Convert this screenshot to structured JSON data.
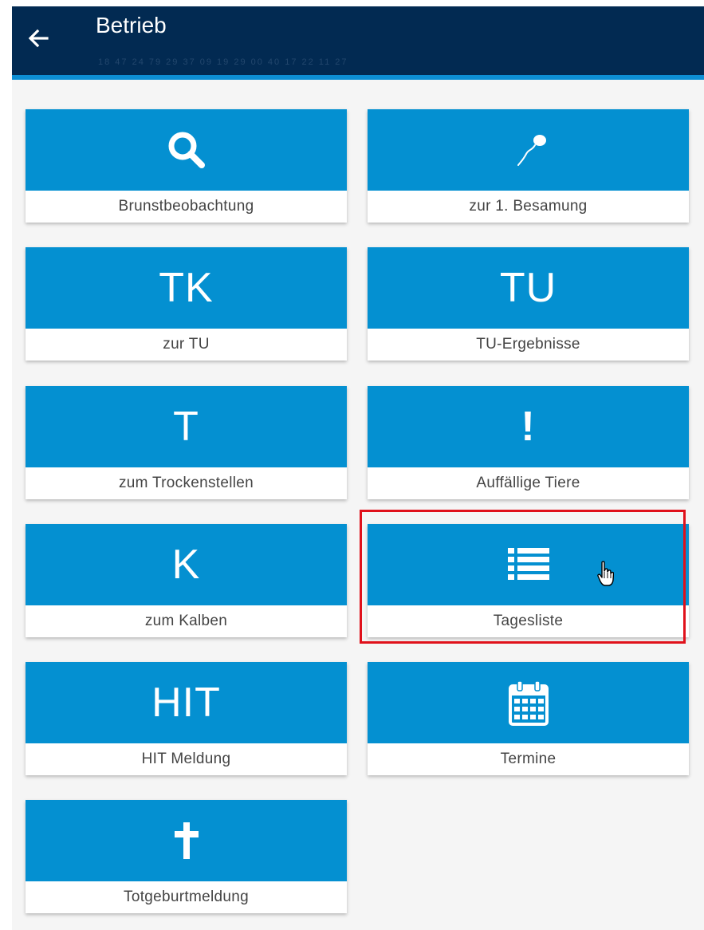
{
  "appbar": {
    "title": "Betrieb",
    "subtitle": "18 47 24 79 29 37 09 19 29 00 40 17 22 11 27",
    "back_icon": "arrow-left-icon"
  },
  "tiles": [
    {
      "label": "Brunstbeobachtung",
      "icon": "search-icon"
    },
    {
      "label": "zur 1. Besamung",
      "icon": "sperm-icon"
    },
    {
      "label": "zur TU",
      "glyph": "TK"
    },
    {
      "label": "TU-Ergebnisse",
      "glyph": "TU"
    },
    {
      "label": "zum Trockenstellen",
      "glyph": "T"
    },
    {
      "label": "Auffällige Tiere",
      "glyph": "!"
    },
    {
      "label": "zum Kalben",
      "glyph": "K"
    },
    {
      "label": "Tagesliste",
      "icon": "list-icon"
    },
    {
      "label": "HIT Meldung",
      "glyph": "HIT"
    },
    {
      "label": "Termine",
      "icon": "calendar-icon"
    },
    {
      "label": "Totgeburtmeldung",
      "icon": "cross-icon"
    }
  ],
  "colors": {
    "appbar": "#022a52",
    "accent": "#0d8fd5",
    "tile": "#0490d1",
    "highlight": "#e0111b"
  }
}
